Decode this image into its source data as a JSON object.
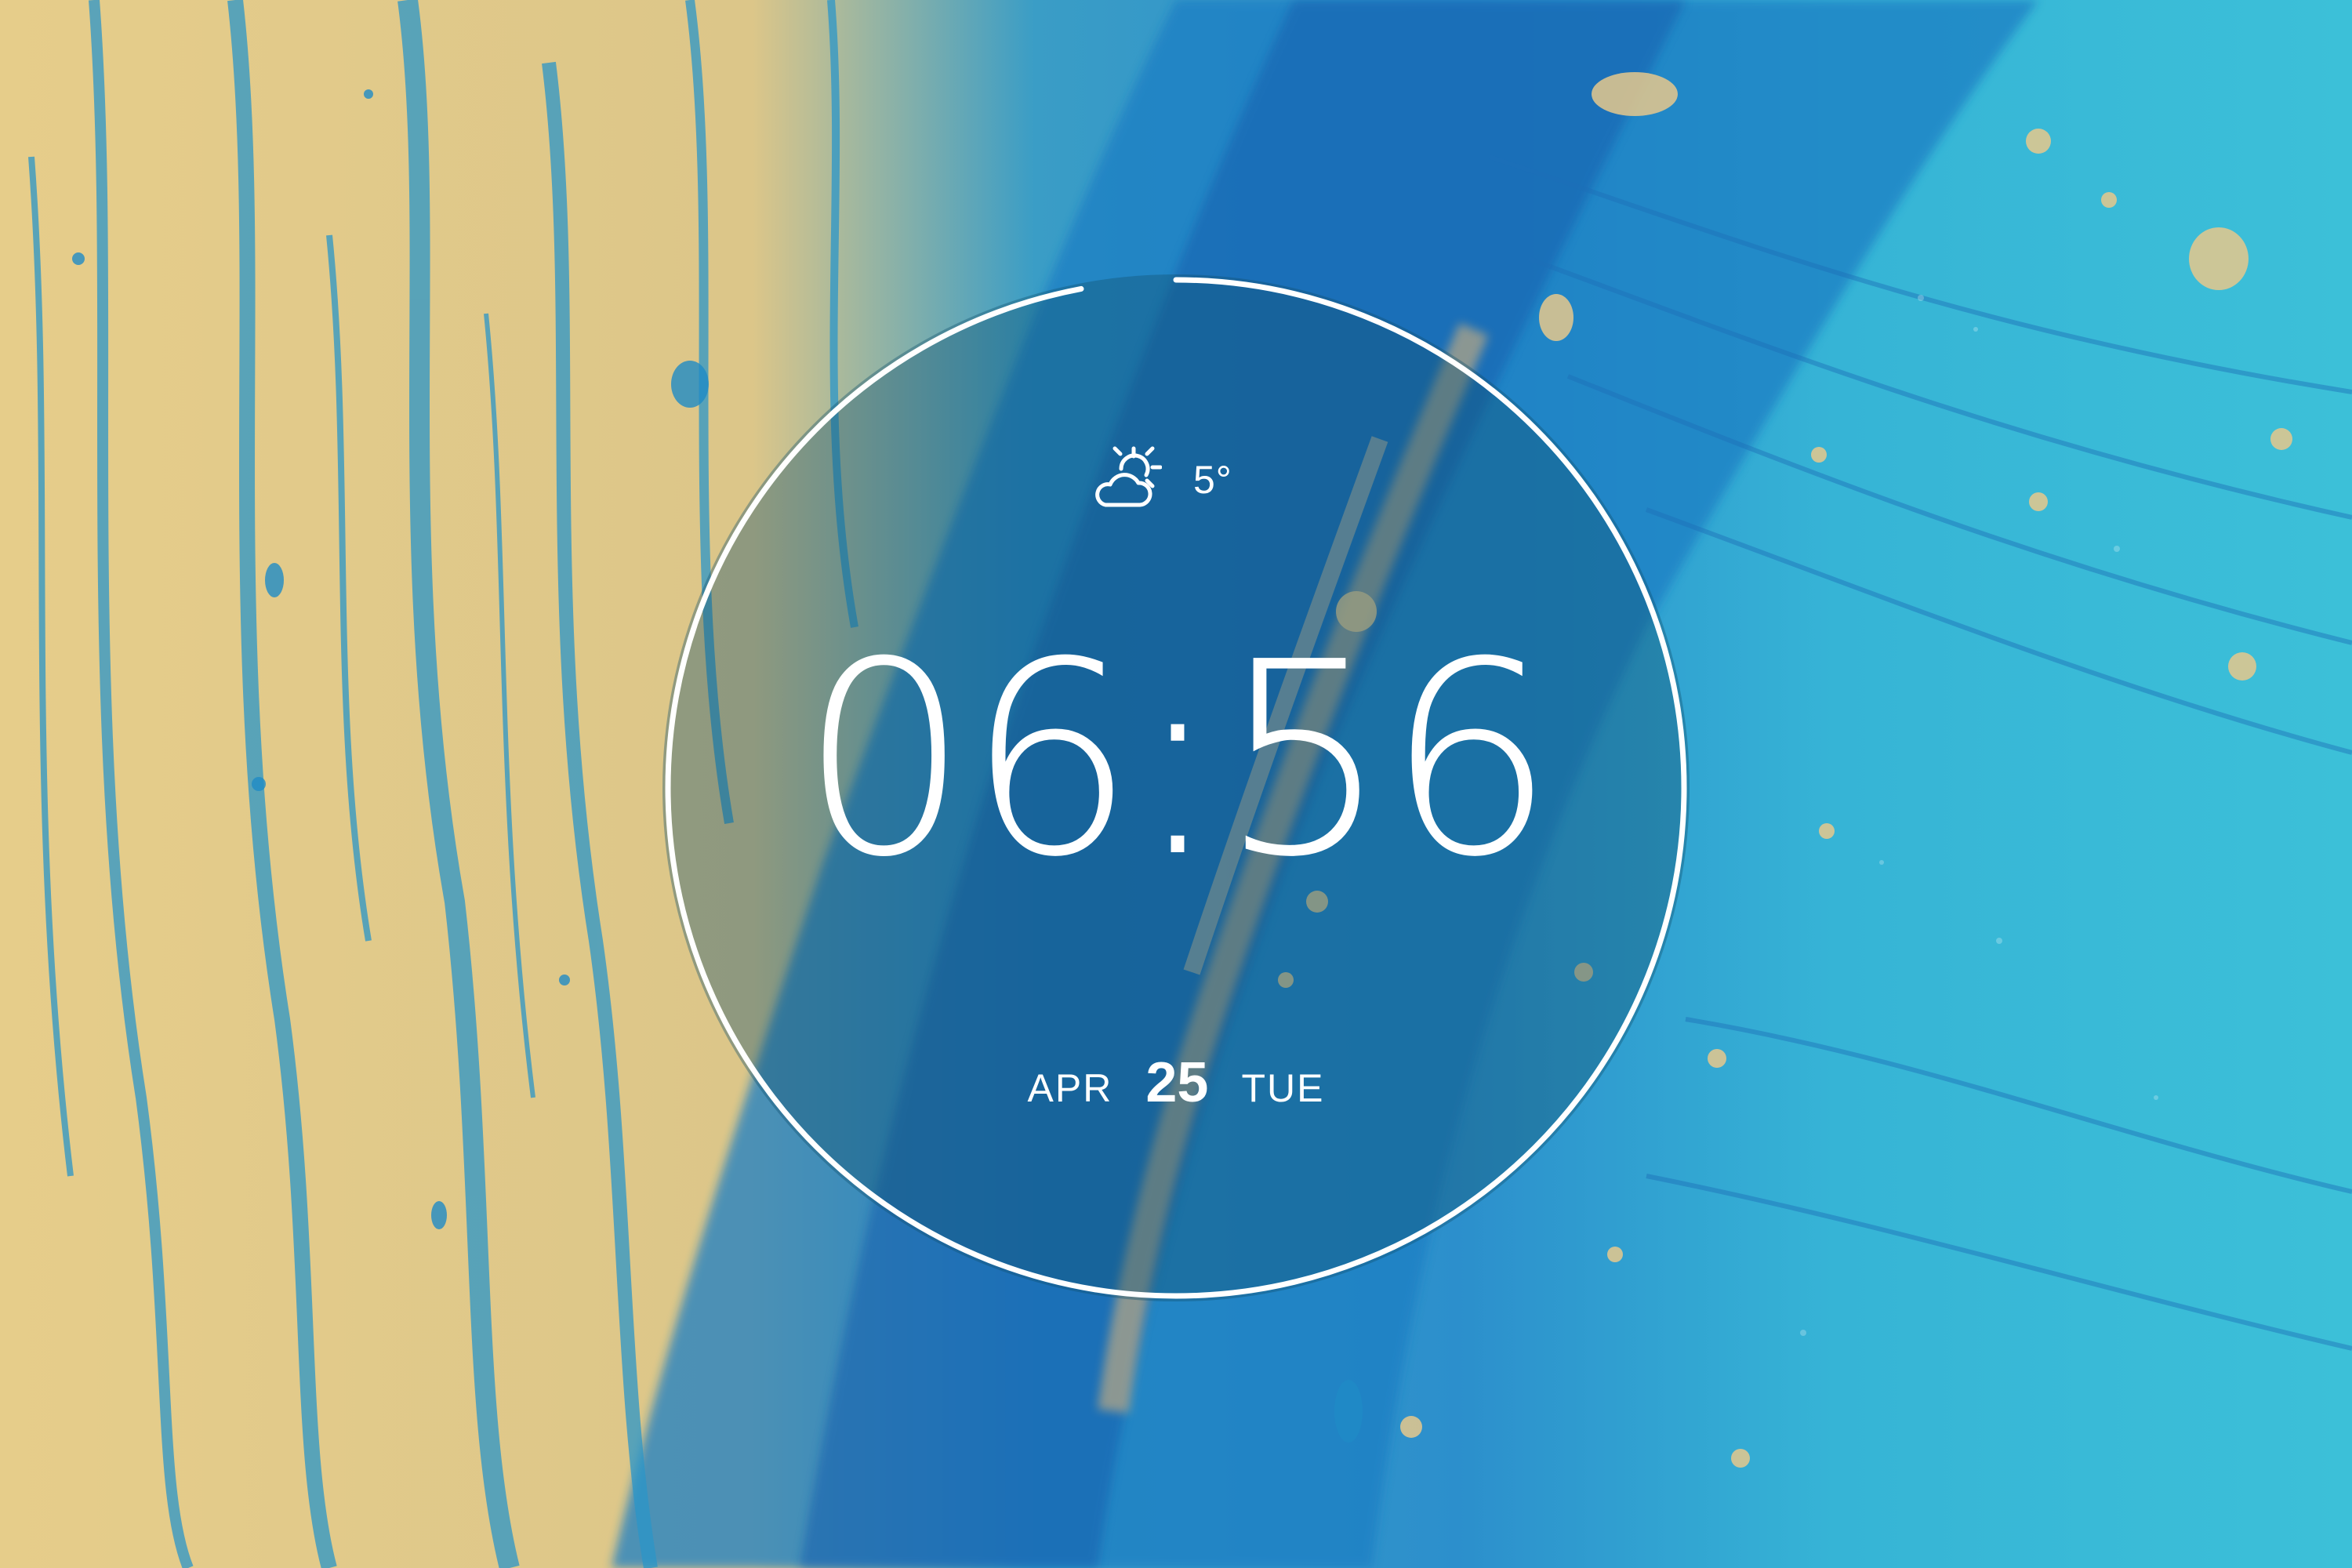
{
  "clock": {
    "time": "06:56",
    "progress_fraction": 0.97
  },
  "weather": {
    "icon": "partly-cloudy-sun-icon",
    "temperature": "5°"
  },
  "date": {
    "month": "APR",
    "day": "25",
    "weekday": "TUE"
  },
  "colors": {
    "ring": "#ffffff",
    "text": "#ffffff",
    "wallpaper_yellow": "#e8d08c",
    "wallpaper_blue": "#1f8fc8",
    "wallpaper_cyan": "#35b8d4"
  }
}
